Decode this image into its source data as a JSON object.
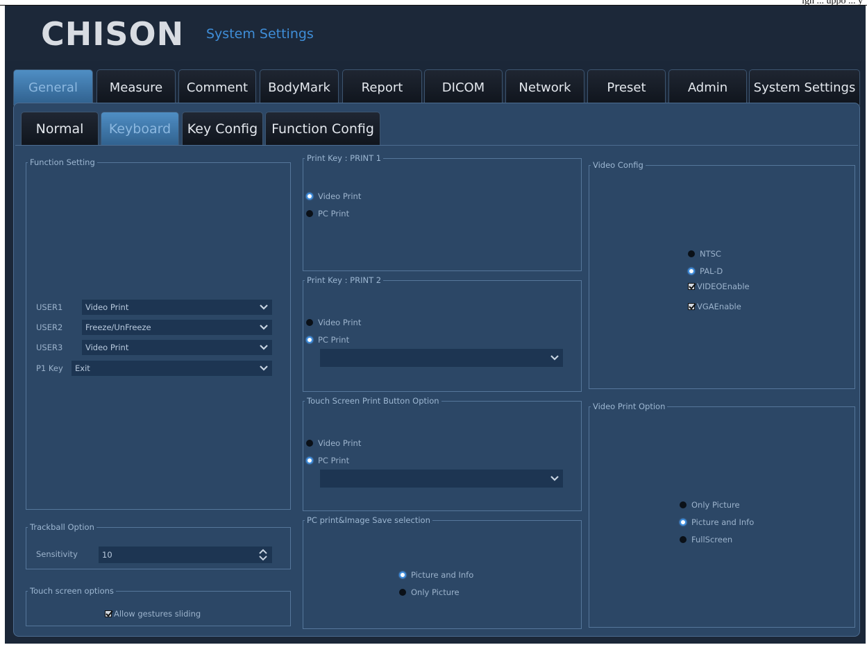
{
  "top_fragment": "igh ... uppo ... y",
  "header": {
    "logo": "CHISON",
    "title": "System Settings"
  },
  "main_tabs": [
    {
      "label": "General",
      "active": true
    },
    {
      "label": "Measure",
      "active": false
    },
    {
      "label": "Comment",
      "active": false
    },
    {
      "label": "BodyMark",
      "active": false
    },
    {
      "label": "Report",
      "active": false
    },
    {
      "label": "DICOM",
      "active": false
    },
    {
      "label": "Network",
      "active": false
    },
    {
      "label": "Preset",
      "active": false
    },
    {
      "label": "Admin",
      "active": false
    },
    {
      "label": "System Settings",
      "active": false
    }
  ],
  "sub_tabs": [
    {
      "label": "Normal",
      "active": false
    },
    {
      "label": "Keyboard",
      "active": true
    },
    {
      "label": "Key Config",
      "active": false
    },
    {
      "label": "Function Config",
      "active": false
    }
  ],
  "function_setting": {
    "legend": "Function Setting",
    "rows": [
      {
        "label": "USER1",
        "value": "Video Print"
      },
      {
        "label": "USER2",
        "value": "Freeze/UnFreeze"
      },
      {
        "label": "USER3",
        "value": "Video Print"
      },
      {
        "label": "P1 Key",
        "value": "Exit"
      }
    ]
  },
  "trackball": {
    "legend": "Trackball Option",
    "label": "Sensitivity",
    "value": "10"
  },
  "touch_options": {
    "legend": "Touch screen options",
    "checkbox": "Allow gestures sliding",
    "checked": true
  },
  "print1": {
    "legend": "Print Key : PRINT 1",
    "options": [
      {
        "label": "Video Print",
        "checked": true
      },
      {
        "label": "PC Print",
        "checked": false
      }
    ]
  },
  "print2": {
    "legend": "Print Key : PRINT 2",
    "options": [
      {
        "label": "Video Print",
        "checked": false
      },
      {
        "label": "PC Print",
        "checked": true
      }
    ],
    "select_value": ""
  },
  "touch_print": {
    "legend": "Touch Screen Print Button Option",
    "options": [
      {
        "label": "Video Print",
        "checked": false
      },
      {
        "label": "PC Print",
        "checked": true
      }
    ],
    "select_value": ""
  },
  "pc_save": {
    "legend": "PC print&Image Save selection",
    "options": [
      {
        "label": "Picture and Info",
        "checked": true
      },
      {
        "label": "Only Picture",
        "checked": false
      }
    ]
  },
  "video_config": {
    "legend": "Video Config",
    "options": [
      {
        "label": "NTSC",
        "checked": false
      },
      {
        "label": "PAL-D",
        "checked": true
      }
    ],
    "checks": [
      {
        "label": "VIDEOEnable",
        "checked": true
      },
      {
        "label": "VGAEnable",
        "checked": true
      }
    ]
  },
  "video_print": {
    "legend": "Video Print Option",
    "options": [
      {
        "label": "Only Picture",
        "checked": false
      },
      {
        "label": "Picture and Info",
        "checked": true
      },
      {
        "label": "FullScreen",
        "checked": false
      }
    ]
  },
  "colors": {
    "accent": "#3e8ddc",
    "panel": "#2c4766",
    "background": "#1b2738",
    "title": "#3f8ed8"
  }
}
